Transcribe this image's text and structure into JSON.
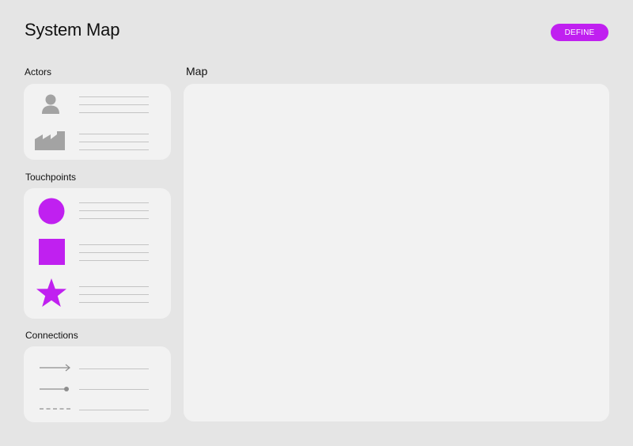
{
  "header": {
    "title": "System Map",
    "define_label": "DEFINE"
  },
  "sections": {
    "actors": {
      "label": "Actors",
      "items": [
        "person-icon",
        "factory-icon"
      ]
    },
    "touchpoints": {
      "label": "Touchpoints",
      "items": [
        "circle-icon",
        "square-icon",
        "star-icon"
      ]
    },
    "connections": {
      "label": "Connections",
      "items": [
        "arrow-connector-icon",
        "dot-end-connector-icon",
        "dashed-connector-icon"
      ]
    }
  },
  "map": {
    "label": "Map"
  },
  "colors": {
    "accent": "#c020f0",
    "gray_icon": "#a3a3a3",
    "card": "#f2f2f2",
    "background": "#e5e5e5"
  }
}
